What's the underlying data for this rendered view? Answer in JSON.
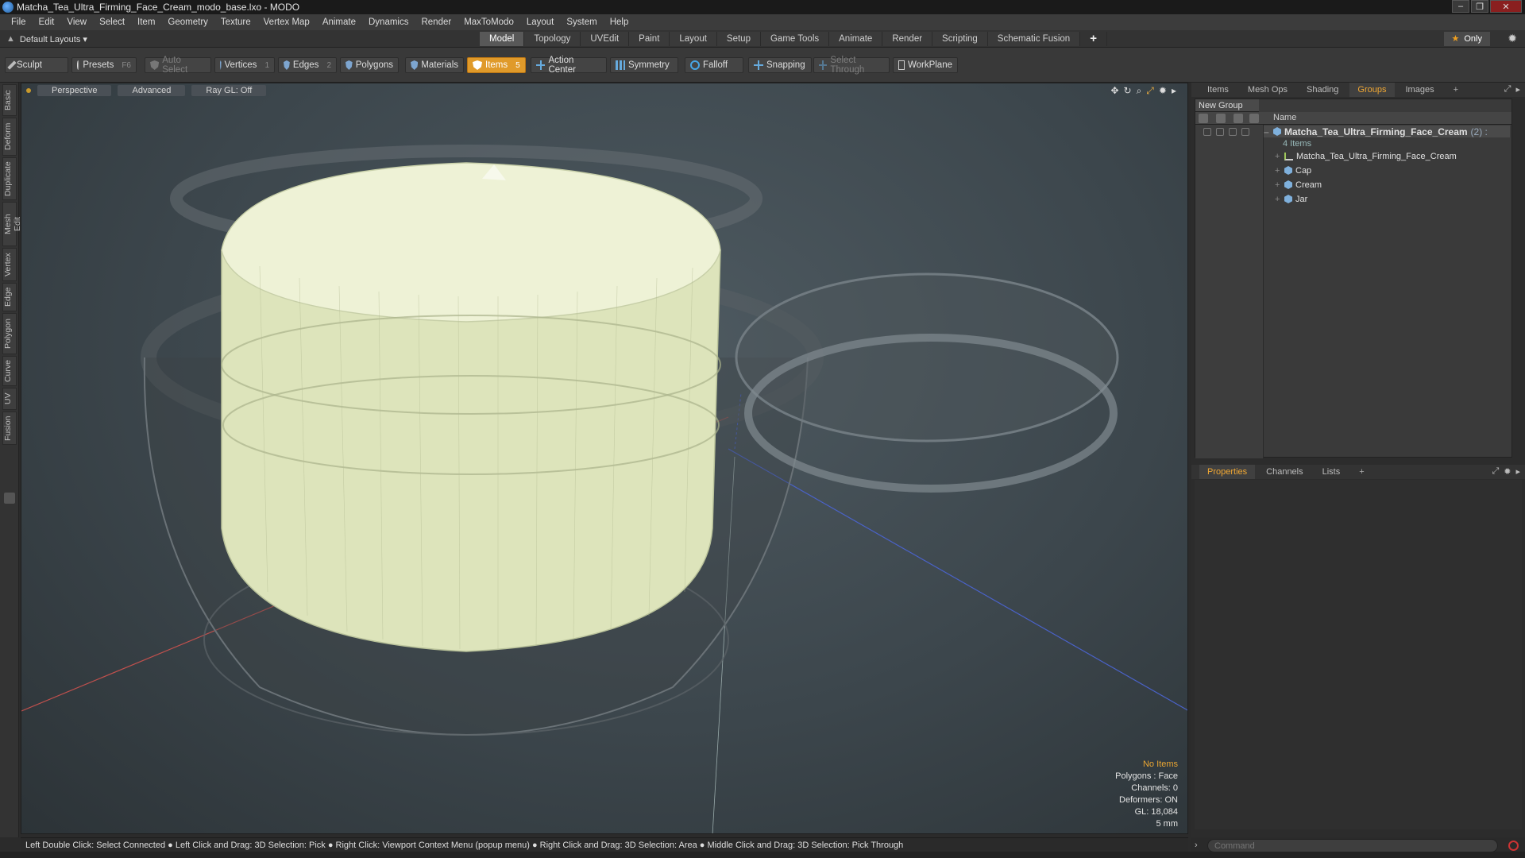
{
  "window": {
    "title": "Matcha_Tea_Ultra_Firming_Face_Cream_modo_base.lxo - MODO",
    "controls": [
      "–",
      "❐",
      "✕"
    ]
  },
  "menubar": {
    "items": [
      "File",
      "Edit",
      "View",
      "Select",
      "Item",
      "Geometry",
      "Texture",
      "Vertex Map",
      "Animate",
      "Dynamics",
      "Render",
      "MaxToModo",
      "Layout",
      "System",
      "Help"
    ]
  },
  "layoutbar": {
    "layout_dropdown": "Default Layouts ▾",
    "tabs": [
      "Model",
      "Topology",
      "UVEdit",
      "Paint",
      "Layout",
      "Setup",
      "Game Tools",
      "Animate",
      "Render",
      "Scripting",
      "Schematic Fusion"
    ],
    "active_tab": "Model",
    "add_tab": "+",
    "only_label": "Only"
  },
  "toolbar": {
    "sculpt": "Sculpt",
    "presets": "Presets",
    "presets_key": "F6",
    "auto_select": "Auto Select",
    "vertices": "Vertices",
    "vertices_num": "1",
    "edges": "Edges",
    "edges_num": "2",
    "polygons": "Polygons",
    "materials": "Materials",
    "items": "Items",
    "items_num": "5",
    "action_center": "Action Center",
    "symmetry": "Symmetry",
    "falloff": "Falloff",
    "snapping": "Snapping",
    "select_through": "Select Through",
    "workplane": "WorkPlane"
  },
  "leftstrip": {
    "tabs": [
      "Basic",
      "Deform",
      "Duplicate",
      "Mesh Edit",
      "Vertex",
      "Edge",
      "Polygon",
      "Curve",
      "UV",
      "Fusion"
    ]
  },
  "viewport": {
    "view_mode": "Perspective",
    "shading": "Advanced",
    "raygl": "Ray GL: Off",
    "info": {
      "selection": "No Items",
      "polygons": "Polygons : Face",
      "channels": "Channels: 0",
      "deformers": "Deformers: ON",
      "gl": "GL: 18,084",
      "unit": "5 mm"
    }
  },
  "groups_panel": {
    "tabs": [
      "Items",
      "Mesh Ops",
      "Shading",
      "Groups",
      "Images"
    ],
    "active_tab": "Groups",
    "add_tab": "+",
    "new_group": "New Group",
    "name_header": "Name",
    "group": {
      "name": "Matcha_Tea_Ultra_Firming_Face_Cream",
      "count": "(2) :",
      "items_label": "4 Items",
      "children": [
        "Matcha_Tea_Ultra_Firming_Face_Cream",
        "Cap",
        "Cream",
        "Jar"
      ]
    }
  },
  "properties_panel": {
    "tabs": [
      "Properties",
      "Channels",
      "Lists"
    ],
    "active_tab": "Properties",
    "add_tab": "+"
  },
  "statusbar": {
    "hint": "Left Double Click: Select Connected ● Left Click and Drag: 3D Selection: Pick ● Right Click: Viewport Context Menu (popup menu) ● Right Click and Drag: 3D Selection: Area ● Middle Click and Drag: 3D Selection: Pick Through"
  },
  "command": {
    "placeholder": "Command"
  },
  "colors": {
    "accent": "#e09a2a",
    "cream": "#e8edcc",
    "viewport_bg": "#3f4a50"
  }
}
